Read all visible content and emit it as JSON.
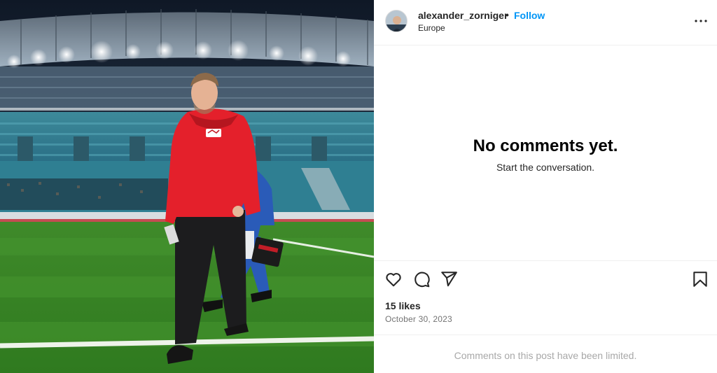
{
  "post": {
    "image_alt": "Coach in red hoodie walking on the pitch in a stadium",
    "author": {
      "username": "alexander_zorniger",
      "separator": "•",
      "follow_label": "Follow",
      "location": "Europe"
    },
    "comments": {
      "empty_title": "No comments yet.",
      "empty_subtitle": "Start the conversation."
    },
    "actions": {
      "like_icon": "heart-icon",
      "comment_icon": "comment-icon",
      "share_icon": "share-icon",
      "save_icon": "bookmark-icon"
    },
    "likes": "15 likes",
    "date": "October 30, 2023",
    "limited_notice": "Comments on this post have been limited."
  },
  "colors": {
    "accent": "#0095f6",
    "text": "#262626",
    "muted": "#737373",
    "disabled": "#a8a8a8",
    "divider": "#efefef"
  }
}
